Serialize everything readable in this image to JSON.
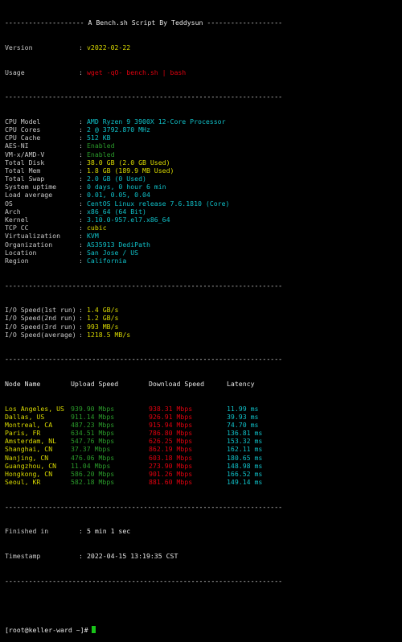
{
  "banner": "-------------------- A Bench.sh Script By Teddysun -------------------",
  "version": {
    "label": "Version",
    "value": "v2022-02-22"
  },
  "usage": {
    "label": "Usage",
    "value": "wget -qO- bench.sh | bash"
  },
  "divider": "----------------------------------------------------------------------",
  "system": [
    {
      "label": "CPU Model",
      "value": "AMD Ryzen 9 3900X 12-Core Processor",
      "color": "cyan"
    },
    {
      "label": "CPU Cores",
      "value": "2 @ 3792.870 MHz",
      "color": "cyan"
    },
    {
      "label": "CPU Cache",
      "value": "512 KB",
      "color": "cyan"
    },
    {
      "label": "AES-NI",
      "value": "Enabled",
      "color": "dgreen"
    },
    {
      "label": "VM-x/AMD-V",
      "value": "Enabled",
      "color": "dgreen"
    },
    {
      "label": "Total Disk",
      "value": "38.0 GB (2.0 GB Used)",
      "color": "yellow"
    },
    {
      "label": "Total Mem",
      "value": "1.8 GB (189.9 MB Used)",
      "color": "yellow"
    },
    {
      "label": "Total Swap",
      "value": "2.0 GB (0 Used)",
      "color": "cyan"
    },
    {
      "label": "System uptime",
      "value": "0 days, 0 hour 6 min",
      "color": "cyan"
    },
    {
      "label": "Load average",
      "value": "0.01, 0.05, 0.04",
      "color": "cyan"
    },
    {
      "label": "OS",
      "value": "CentOS Linux release 7.6.1810 (Core)",
      "color": "cyan"
    },
    {
      "label": "Arch",
      "value": "x86_64 (64 Bit)",
      "color": "cyan"
    },
    {
      "label": "Kernel",
      "value": "3.10.0-957.el7.x86_64",
      "color": "cyan"
    },
    {
      "label": "TCP CC",
      "value": "cubic",
      "color": "yellow"
    },
    {
      "label": "Virtualization",
      "value": "KVM",
      "color": "cyan"
    },
    {
      "label": "Organization",
      "value": "AS35913 DediPath",
      "color": "cyan"
    },
    {
      "label": "Location",
      "value": "San Jose / US",
      "color": "cyan"
    },
    {
      "label": "Region",
      "value": "California",
      "color": "cyan"
    }
  ],
  "io": [
    {
      "label": "I/O Speed(1st run)",
      "value": "1.4 GB/s"
    },
    {
      "label": "I/O Speed(2nd run)",
      "value": "1.2 GB/s"
    },
    {
      "label": "I/O Speed(3rd run)",
      "value": "993 MB/s"
    },
    {
      "label": "I/O Speed(average)",
      "value": "1218.5 MB/s"
    }
  ],
  "speed_headers": [
    "Node Name",
    "Upload Speed",
    "Download Speed",
    "Latency"
  ],
  "speed_rows": [
    {
      "node": "Los Angeles, US",
      "up": "939.90 Mbps",
      "down": "938.31 Mbps",
      "lat": "11.99 ms"
    },
    {
      "node": "Dallas, US",
      "up": "911.14 Mbps",
      "down": "926.91 Mbps",
      "lat": "39.93 ms"
    },
    {
      "node": "Montreal, CA",
      "up": "487.23 Mbps",
      "down": "915.94 Mbps",
      "lat": "74.70 ms"
    },
    {
      "node": "Paris, FR",
      "up": "634.51 Mbps",
      "down": "786.80 Mbps",
      "lat": "136.81 ms"
    },
    {
      "node": "Amsterdam, NL",
      "up": "547.76 Mbps",
      "down": "626.25 Mbps",
      "lat": "153.32 ms"
    },
    {
      "node": "Shanghai, CN",
      "up": "37.37 Mbps",
      "down": "862.19 Mbps",
      "lat": "162.11 ms"
    },
    {
      "node": "Nanjing, CN",
      "up": "476.06 Mbps",
      "down": "603.18 Mbps",
      "lat": "180.65 ms"
    },
    {
      "node": "Guangzhou, CN",
      "up": "11.04 Mbps",
      "down": "273.90 Mbps",
      "lat": "148.98 ms"
    },
    {
      "node": "Hongkong, CN",
      "up": "586.20 Mbps",
      "down": "901.26 Mbps",
      "lat": "166.52 ms"
    },
    {
      "node": "Seoul, KR",
      "up": "582.18 Mbps",
      "down": "881.60 Mbps",
      "lat": "149.14 ms"
    }
  ],
  "finished": {
    "label": "Finished in",
    "value": "5 min 1 sec"
  },
  "timestamp": {
    "label": "Timestamp",
    "value": "2022-04-15 13:19:35 CST"
  },
  "prompt": "[root@keller-ward ~]#",
  "colors": {
    "background": "#000000",
    "cyan": "#10c0c8",
    "yellow": "#d9d900",
    "red": "#e0000f",
    "green": "#19c419",
    "purple": "#c040c0"
  }
}
